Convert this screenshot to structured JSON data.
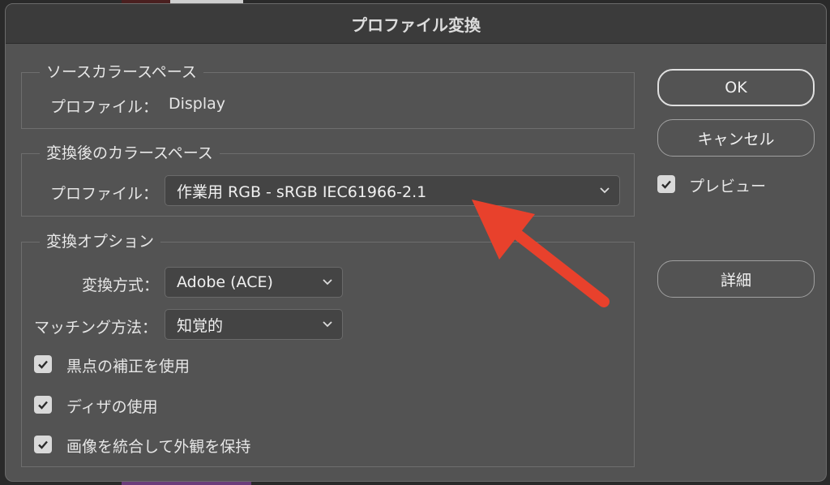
{
  "dialog": {
    "title": "プロファイル変換"
  },
  "source": {
    "legend": "ソースカラースペース",
    "profile_label": "プロファイル：",
    "profile_value": "Display"
  },
  "destination": {
    "legend": "変換後のカラースペース",
    "profile_label": "プロファイル：",
    "profile_value": "作業用 RGB - sRGB IEC61966-2.1"
  },
  "options": {
    "legend": "変換オプション",
    "engine_label": "変換方式：",
    "engine_value": "Adobe (ACE)",
    "intent_label": "マッチング方法：",
    "intent_value": "知覚的",
    "checkboxes": [
      {
        "label": "黒点の補正を使用",
        "checked": true
      },
      {
        "label": "ディザの使用",
        "checked": true
      },
      {
        "label": "画像を統合して外観を保持",
        "checked": true
      }
    ]
  },
  "buttons": {
    "ok": "OK",
    "cancel": "キャンセル",
    "advanced": "詳細"
  },
  "preview": {
    "label": "プレビュー",
    "checked": true
  },
  "colors": {
    "dialog_bg": "#535353",
    "annotation_arrow": "#e8412c"
  },
  "icons": {
    "dropdown": "chevron-down-icon",
    "check": "checkmark-icon",
    "annotation": "annotation-arrow-icon"
  }
}
